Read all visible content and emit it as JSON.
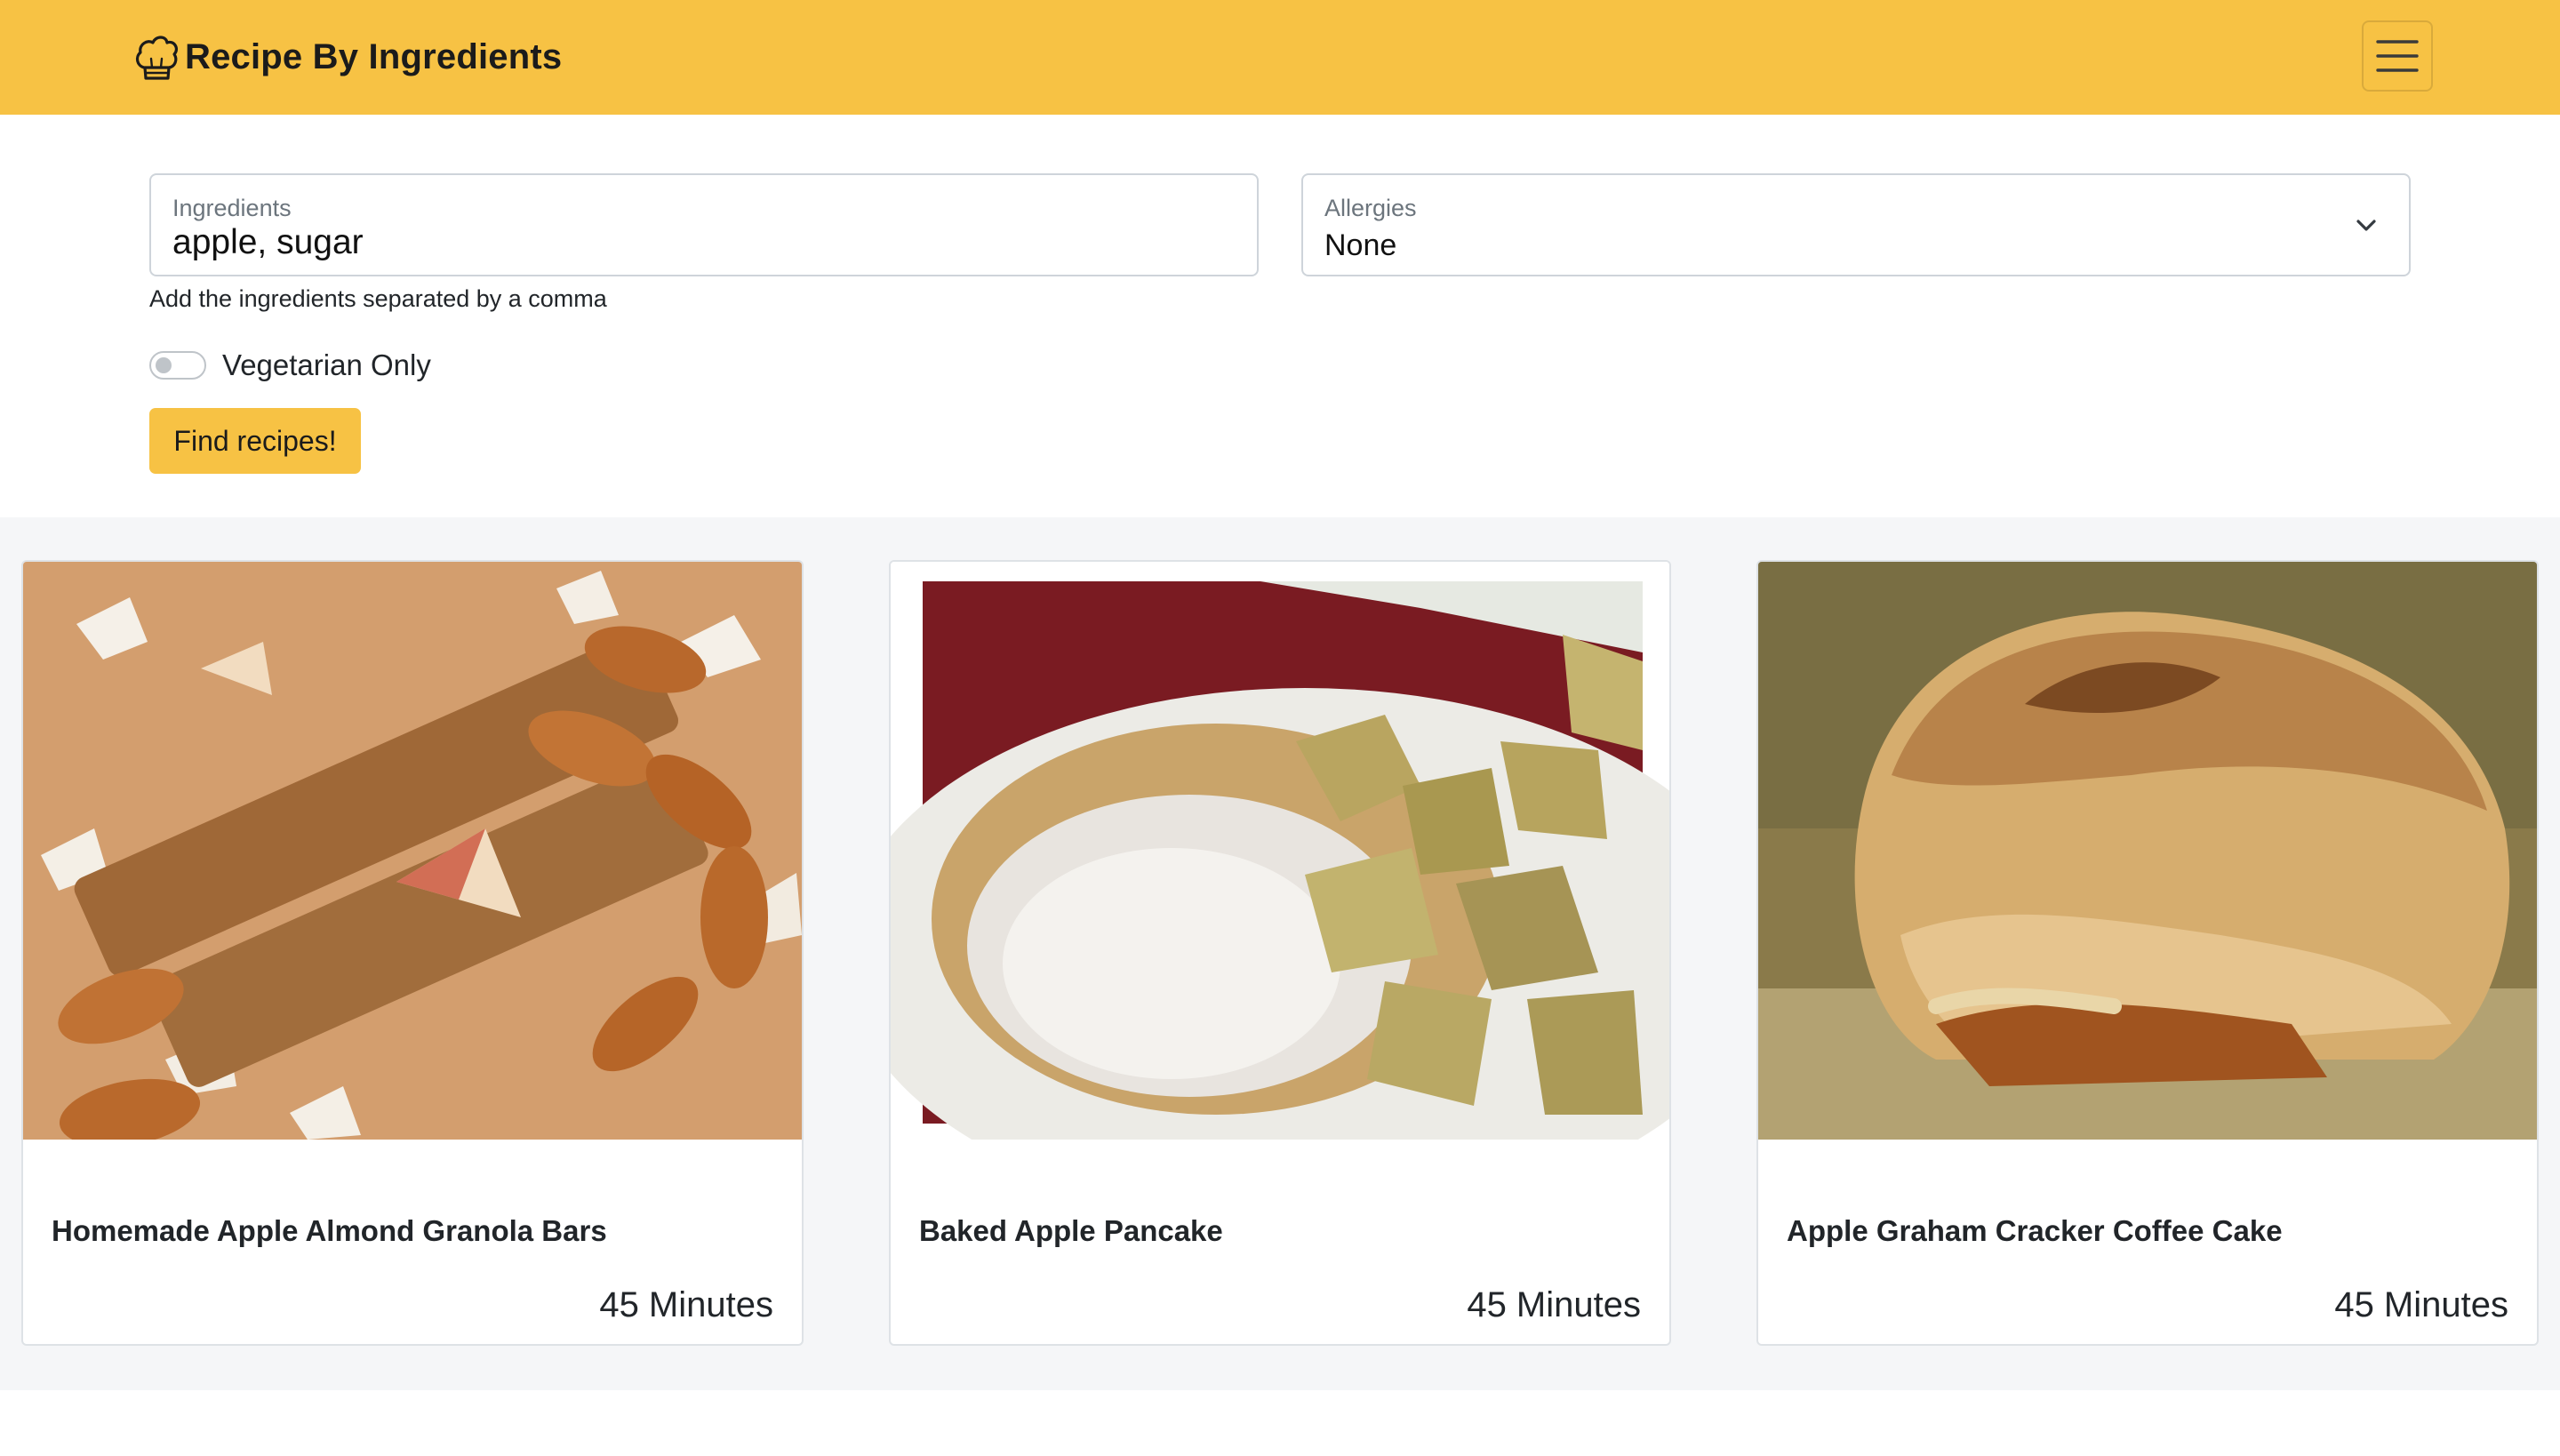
{
  "navbar": {
    "brand": "Recipe By Ingredients",
    "brand_icon": "chef-hat-icon",
    "menu_icon": "hamburger-menu-icon",
    "bg_color": "#f7c244"
  },
  "search": {
    "ingredients_label": "Ingredients",
    "ingredients_value": "apple, sugar",
    "ingredients_help": "Add the ingredients separated by a comma",
    "allergies_label": "Allergies",
    "allergies_value": "None",
    "vegetarian_label": "Vegetarian Only",
    "vegetarian_on": false,
    "submit_label": "Find recipes!"
  },
  "recipes": [
    {
      "title": "Homemade Apple Almond Granola Bars",
      "time": "45 Minutes",
      "image_icon": "granola-bars-photo"
    },
    {
      "title": "Baked Apple Pancake",
      "time": "45 Minutes",
      "image_icon": "apple-pancake-photo"
    },
    {
      "title": "Apple Graham Cracker Coffee Cake",
      "time": "45 Minutes",
      "image_icon": "coffee-cake-photo"
    }
  ]
}
